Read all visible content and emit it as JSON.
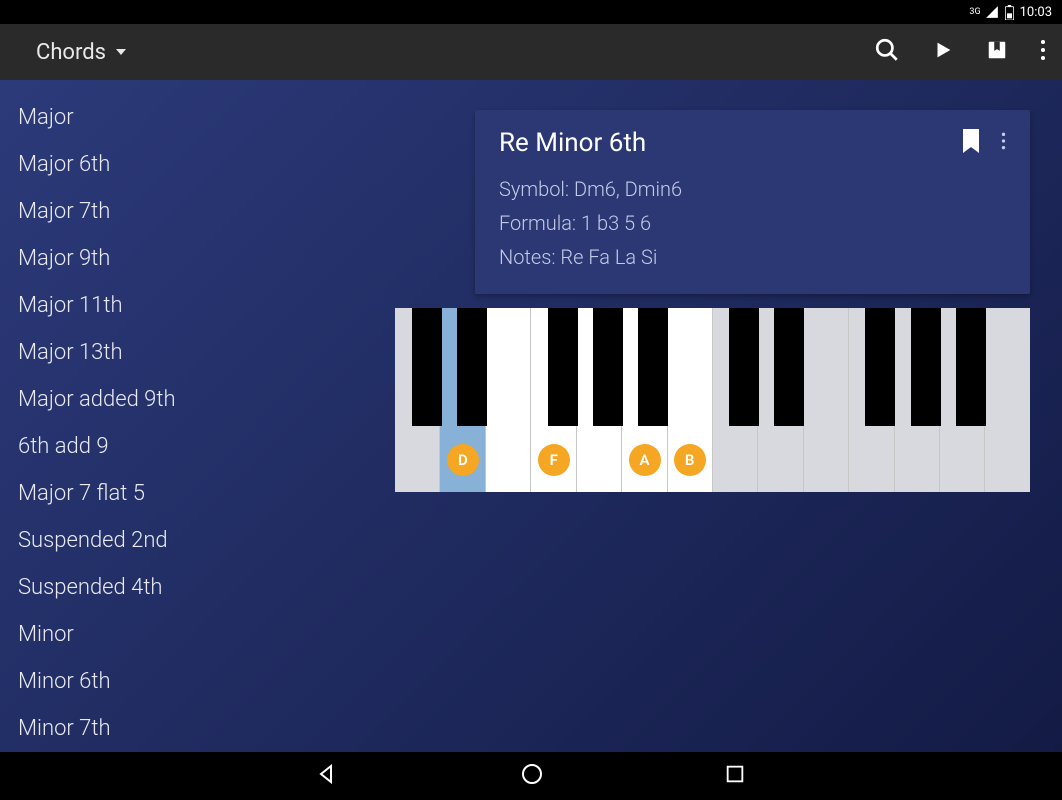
{
  "status": {
    "net": "3G",
    "time": "10:03"
  },
  "appbar": {
    "title": "Chords"
  },
  "sidebar": {
    "items": [
      {
        "label": "Major"
      },
      {
        "label": "Major 6th"
      },
      {
        "label": "Major 7th"
      },
      {
        "label": "Major 9th"
      },
      {
        "label": "Major 11th"
      },
      {
        "label": "Major 13th"
      },
      {
        "label": "Major added 9th"
      },
      {
        "label": "6th add 9"
      },
      {
        "label": "Major 7 flat 5"
      },
      {
        "label": "Suspended 2nd"
      },
      {
        "label": "Suspended 4th"
      },
      {
        "label": "Minor"
      },
      {
        "label": "Minor 6th"
      },
      {
        "label": "Minor 7th"
      }
    ]
  },
  "chord": {
    "title": "Re Minor 6th",
    "symbol_line": "Symbol: Dm6, Dmin6",
    "formula_line": "Formula: 1 b3 5 6",
    "notes_line": "Notes: Re Fa La Si"
  },
  "piano": {
    "white_keys": [
      {
        "dim": true,
        "hl": false
      },
      {
        "dim": false,
        "hl": true,
        "marker": "D"
      },
      {
        "dim": false,
        "hl": false
      },
      {
        "dim": false,
        "hl": false,
        "marker": "F"
      },
      {
        "dim": false,
        "hl": false
      },
      {
        "dim": false,
        "hl": false,
        "marker": "A"
      },
      {
        "dim": false,
        "hl": false,
        "marker": "B"
      },
      {
        "dim": true,
        "hl": false
      },
      {
        "dim": true,
        "hl": false
      },
      {
        "dim": true,
        "hl": false
      },
      {
        "dim": true,
        "hl": false
      },
      {
        "dim": true,
        "hl": false
      },
      {
        "dim": true,
        "hl": false
      },
      {
        "dim": true,
        "hl": false
      }
    ],
    "black_key_positions_pct": [
      5.0,
      12.1,
      26.4,
      33.6,
      40.7,
      55.0,
      62.1,
      76.4,
      83.6,
      90.7
    ],
    "markers": [
      {
        "label": "D",
        "pct": 10.7
      },
      {
        "label": "F",
        "pct": 25.0
      },
      {
        "label": "A",
        "pct": 39.3
      },
      {
        "label": "B",
        "pct": 46.4
      }
    ]
  },
  "colors": {
    "accent": "#f5a623",
    "card": "#2c3874"
  }
}
